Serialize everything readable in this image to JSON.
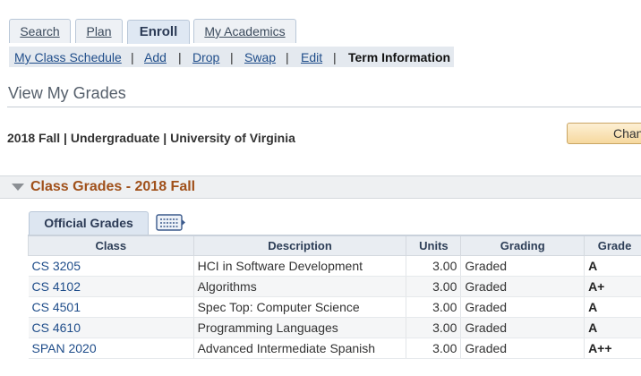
{
  "tabs": [
    {
      "label": "Search",
      "active": false
    },
    {
      "label": "Plan",
      "active": false
    },
    {
      "label": "Enroll",
      "active": true
    },
    {
      "label": "My Academics",
      "active": false
    }
  ],
  "subnav": {
    "links": [
      "My Class Schedule",
      "Add",
      "Drop",
      "Swap",
      "Edit"
    ],
    "current": "Term Information",
    "separator": "|"
  },
  "page": {
    "title": "View My Grades",
    "term_info": "2018 Fall | Undergraduate | University of Virginia",
    "change_button": "Change"
  },
  "section": {
    "title": "Class Grades - 2018 Fall",
    "grid_tab": "Official Grades",
    "view_all_icon": "grid-view-icon"
  },
  "table": {
    "headers": [
      "Class",
      "Description",
      "Units",
      "Grading",
      "Grade"
    ],
    "rows": [
      {
        "class": "CS 3205",
        "description": "HCI in Software Development",
        "units": "3.00",
        "grading": "Graded",
        "grade": "A"
      },
      {
        "class": "CS 4102",
        "description": "Algorithms",
        "units": "3.00",
        "grading": "Graded",
        "grade": "A+"
      },
      {
        "class": "CS 4501",
        "description": "Spec Top: Computer Science",
        "units": "3.00",
        "grading": "Graded",
        "grade": "A"
      },
      {
        "class": "CS 4610",
        "description": "Programming Languages",
        "units": "3.00",
        "grading": "Graded",
        "grade": "A"
      },
      {
        "class": "SPAN 2020",
        "description": "Advanced Intermediate Spanish",
        "units": "3.00",
        "grading": "Graded",
        "grade": "A++"
      }
    ]
  },
  "colors": {
    "section_title": "#a0501a",
    "link": "#1f4d8a",
    "button": "#f6d89e"
  }
}
